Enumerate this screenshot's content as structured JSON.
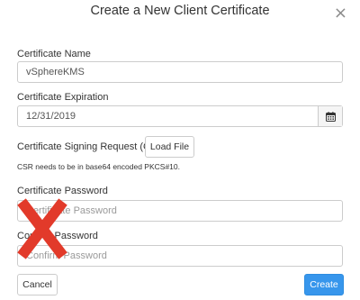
{
  "dialog": {
    "title": "Create a New Client Certificate",
    "close_glyph": "×"
  },
  "form": {
    "certificate_name": {
      "label": "Certificate Name",
      "value": "vSphereKMS"
    },
    "certificate_expiration": {
      "label": "Certificate Expiration",
      "value": "12/31/2019",
      "icon": "calendar-icon"
    },
    "csr": {
      "label": "Certificate Signing Request (CSR)",
      "button_label": "Load File",
      "help_text": "CSR needs to be in base64 encoded PKCS#10."
    },
    "certificate_password": {
      "label": "Certificate Password",
      "placeholder": "Certificate Password"
    },
    "confirm_password": {
      "label": "Confirm Password",
      "placeholder": "Confirm Password"
    }
  },
  "footer": {
    "cancel_label": "Cancel",
    "create_label": "Create"
  },
  "overlay": {
    "mark": "red-x-mark",
    "color": "#e23a2a"
  },
  "colors": {
    "primary": "#3796ec",
    "border": "#cccccc",
    "text": "#333333"
  }
}
